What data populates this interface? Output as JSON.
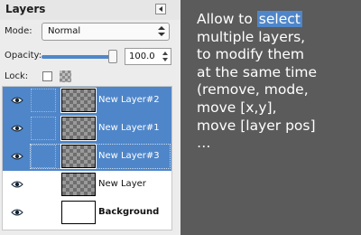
{
  "panel": {
    "title": "Layers",
    "mode_label": "Mode:",
    "mode_value": "Normal",
    "opacity_label": "Opacity:",
    "opacity_value": "100.0",
    "lock_label": "Lock:"
  },
  "layers": [
    {
      "name": "New Layer#2",
      "selected": true,
      "thumbnail": "checker"
    },
    {
      "name": "New Layer#1",
      "selected": true,
      "thumbnail": "checker"
    },
    {
      "name": "New Layer#3",
      "selected": true,
      "thumbnail": "checker"
    },
    {
      "name": "New Layer",
      "selected": false,
      "thumbnail": "checker"
    },
    {
      "name": "Background",
      "selected": false,
      "thumbnail": "white"
    }
  ],
  "caption": {
    "line1_before": "Allow to ",
    "line1_highlight": "select",
    "lines": [
      "multiple layers,",
      "to modify them",
      "at the same time",
      "(remove, mode,",
      "move [x,y],",
      "move [layer pos]",
      "…"
    ]
  },
  "colors": {
    "selection": "#4f86c9",
    "background": "#5b5b5b"
  },
  "icons": {
    "visibility": "eye-icon",
    "panel_menu": "triangle-left-icon"
  }
}
